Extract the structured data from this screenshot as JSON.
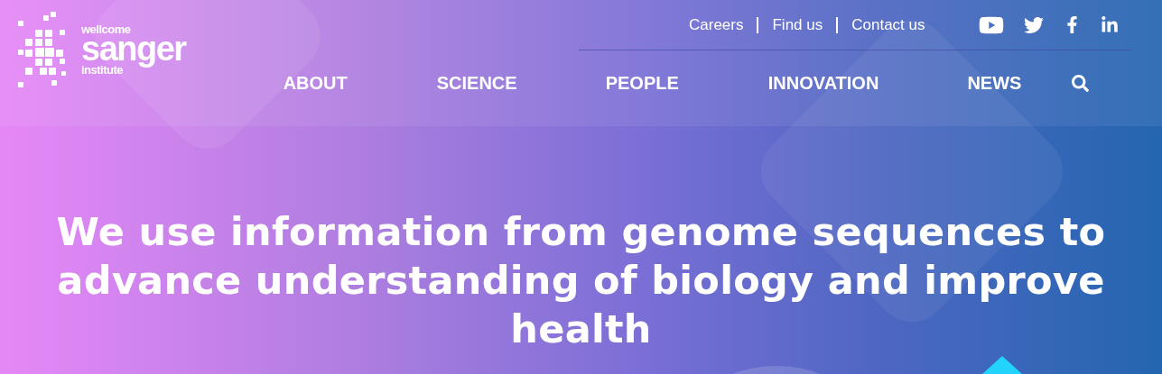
{
  "logo": {
    "top": "wellcome",
    "main": "sanger",
    "bottom": "institute"
  },
  "utility_links": [
    "Careers",
    "Find us",
    "Contact us"
  ],
  "nav": [
    "ABOUT",
    "SCIENCE",
    "PEOPLE",
    "INNOVATION",
    "NEWS"
  ],
  "hero": {
    "headline": "We use information from genome sequences to advance understanding of biology and improve health"
  }
}
